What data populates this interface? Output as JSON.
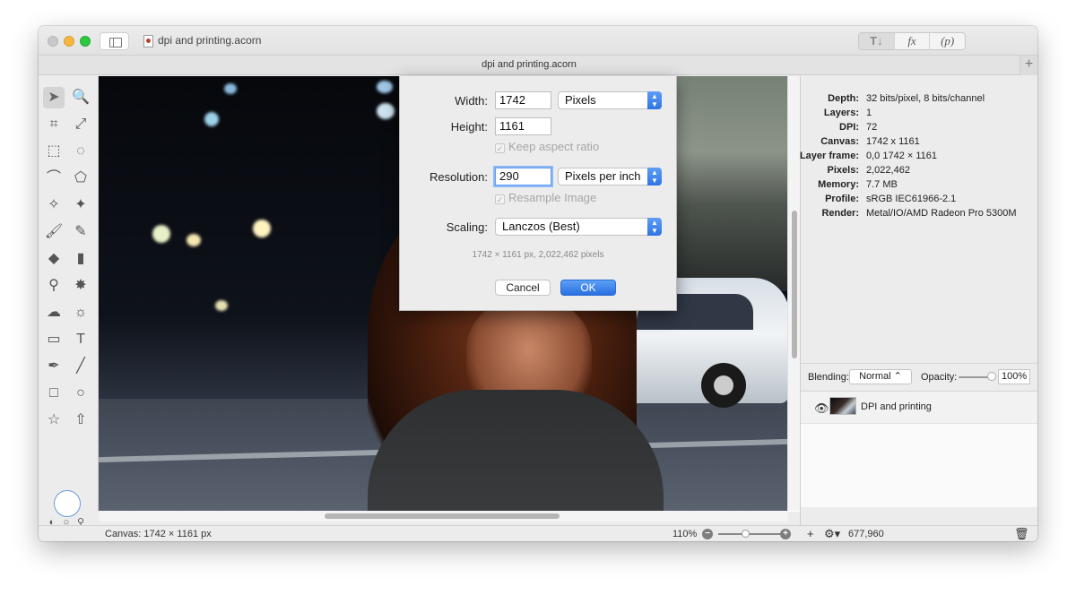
{
  "window": {
    "title": "dpi and printing.acorn",
    "tab_title": "dpi and printing.acorn",
    "toolbar_segments": [
      "T↓",
      "fx",
      "(p)"
    ]
  },
  "tools": [
    {
      "name": "move-tool",
      "glyph": "➤",
      "selected": true
    },
    {
      "name": "zoom-tool",
      "glyph": "🔍"
    },
    {
      "name": "crop-tool",
      "glyph": "⌗"
    },
    {
      "name": "transform-tool",
      "glyph": "⤢"
    },
    {
      "name": "rect-select-tool",
      "glyph": "⬚"
    },
    {
      "name": "ellipse-select-tool",
      "glyph": "◌"
    },
    {
      "name": "lasso-tool",
      "glyph": "⌒"
    },
    {
      "name": "polygon-lasso-tool",
      "glyph": "⬠"
    },
    {
      "name": "magic-wand-tool",
      "glyph": "✧"
    },
    {
      "name": "color-select-tool",
      "glyph": "✦"
    },
    {
      "name": "brush-tool",
      "glyph": "🖌"
    },
    {
      "name": "pencil-tool",
      "glyph": "✎"
    },
    {
      "name": "fill-tool",
      "glyph": "◆"
    },
    {
      "name": "gradient-tool",
      "glyph": "▮"
    },
    {
      "name": "clone-tool",
      "glyph": "⚲"
    },
    {
      "name": "smudge-tool",
      "glyph": "✸"
    },
    {
      "name": "cloud-tool",
      "glyph": "☁"
    },
    {
      "name": "sun-tool",
      "glyph": "☼"
    },
    {
      "name": "rectangle-gradient-tool",
      "glyph": "▭"
    },
    {
      "name": "text-tool",
      "glyph": "T"
    },
    {
      "name": "pen-tool",
      "glyph": "✒"
    },
    {
      "name": "line-tool",
      "glyph": "╱"
    },
    {
      "name": "rectangle-tool",
      "glyph": "□"
    },
    {
      "name": "oval-tool",
      "glyph": "○"
    },
    {
      "name": "star-tool",
      "glyph": "☆"
    },
    {
      "name": "arrow-tool",
      "glyph": "⇧"
    }
  ],
  "dialog": {
    "width_label": "Width:",
    "width_value": "1742",
    "width_unit": "Pixels",
    "height_label": "Height:",
    "height_value": "1161",
    "keep_aspect_label": "Keep aspect ratio",
    "resolution_label": "Resolution:",
    "resolution_value": "290",
    "resolution_unit": "Pixels per inch",
    "resample_label": "Resample Image",
    "scaling_label": "Scaling:",
    "scaling_value": "Lanczos (Best)",
    "info": "1742 × 1161 px, 2,022,462 pixels",
    "cancel_label": "Cancel",
    "ok_label": "OK"
  },
  "inspector": {
    "info": [
      {
        "k": "Depth:",
        "v": "32 bits/pixel, 8 bits/channel"
      },
      {
        "k": "Layers:",
        "v": "1"
      },
      {
        "k": "DPI:",
        "v": "72"
      },
      {
        "k": "Canvas:",
        "v": "1742 x 1161"
      },
      {
        "k": "Layer frame:",
        "v": "0,0 1742 × 1161"
      },
      {
        "k": "Pixels:",
        "v": "2,022,462"
      },
      {
        "k": "Memory:",
        "v": "7.7 MB"
      },
      {
        "k": "Profile:",
        "v": "sRGB IEC61966-2.1"
      },
      {
        "k": "Render:",
        "v": "Metal/IO/AMD Radeon Pro 5300M"
      }
    ],
    "blending_label": "Blending:",
    "blending_value": "Normal",
    "opacity_label": "Opacity:",
    "opacity_value": "100%",
    "layers": [
      {
        "name": "DPI and printing"
      }
    ]
  },
  "status": {
    "canvas_text": "Canvas: 1742 × 1161 px",
    "zoom": "110%",
    "layer_count_value": "677,960"
  }
}
